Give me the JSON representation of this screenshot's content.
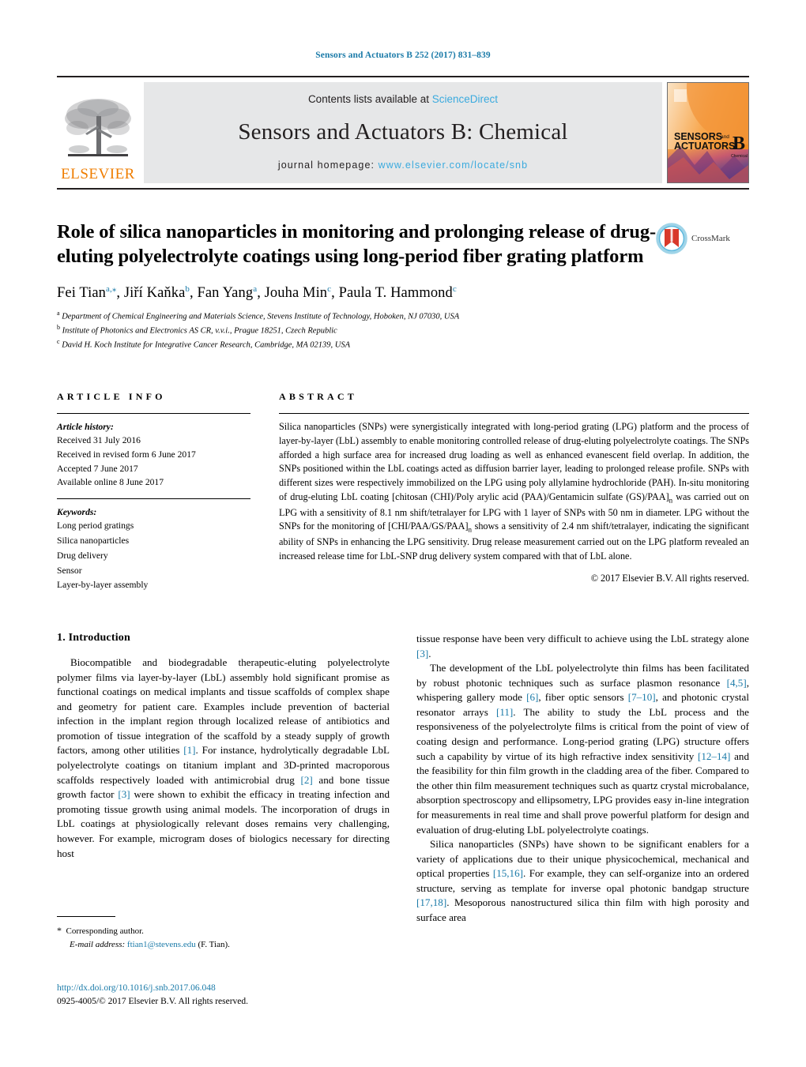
{
  "running_head": "Sensors and Actuators B 252 (2017) 831–839",
  "masthead": {
    "publisher_name": "ELSEVIER",
    "contents_prefix": "Contents lists available at ",
    "contents_link": "ScienceDirect",
    "journal_title": "Sensors and Actuators B: Chemical",
    "homepage_prefix": "journal homepage: ",
    "homepage_url": "www.elsevier.com/locate/snb",
    "cover_line1": "SENSORS",
    "cover_and": "and",
    "cover_line2": "ACTUATORS",
    "cover_letter": "B",
    "cover_sub": "Chemical"
  },
  "title": "Role of silica nanoparticles in monitoring and prolonging release of drug-eluting polyelectrolyte coatings using long-period fiber grating platform",
  "crossmark_label": "CrossMark",
  "authors_html": "Fei Tian<sup>a,⁎</sup>, Jiří Kaňka<sup>b</sup>, Fan Yang<sup>a</sup>, Jouha Min<sup>c</sup>, Paula T. Hammond<sup>c</sup>",
  "affiliations": [
    {
      "marker": "a",
      "text": "Department of Chemical Engineering and Materials Science, Stevens Institute of Technology, Hoboken, NJ 07030, USA"
    },
    {
      "marker": "b",
      "text": "Institute of Photonics and Electronics AS CR, v.v.i., Prague 18251, Czech Republic"
    },
    {
      "marker": "c",
      "text": "David H. Koch Institute for Integrative Cancer Research, Cambridge, MA 02139, USA"
    }
  ],
  "article_info": {
    "kicker": "ARTICLE INFO",
    "history_heading": "Article history:",
    "history": [
      "Received 31 July 2016",
      "Received in revised form 6 June 2017",
      "Accepted 7 June 2017",
      "Available online 8 June 2017"
    ],
    "keywords_heading": "Keywords:",
    "keywords": [
      "Long period gratings",
      "Silica nanoparticles",
      "Drug delivery",
      "Sensor",
      "Layer-by-layer assembly"
    ]
  },
  "abstract": {
    "kicker": "ABSTRACT",
    "text_html": "Silica nanoparticles (SNPs) were synergistically integrated with long-period grating (LPG) platform and the process of layer-by-layer (LbL) assembly to enable monitoring controlled release of drug-eluting polyelectrolyte coatings. The SNPs afforded a high surface area for increased drug loading as well as enhanced evanescent field overlap. In addition, the SNPs positioned within the LbL coatings acted as diffusion barrier layer, leading to prolonged release profile. SNPs with different sizes were respectively immobilized on the LPG using poly allylamine hydrochloride (PAH). In-situ monitoring of drug-eluting LbL coating [chitosan (CHI)/Poly arylic acid (PAA)/Gentamicin sulfate (GS)/PAA]<sub>n</sub> was carried out on LPG with a sensitivity of 8.1 nm shift/tetralayer for LPG with 1 layer of SNPs with 50 nm in diameter. LPG without the SNPs for the monitoring of [CHI/PAA/GS/PAA]<sub>n</sub> shows a sensitivity of 2.4 nm shift/tetralayer, indicating the significant ability of SNPs in enhancing the LPG sensitivity. Drug release measurement carried out on the LPG platform revealed an increased release time for LbL-SNP drug delivery system compared with that of LbL alone.",
    "copyright": "© 2017 Elsevier B.V. All rights reserved."
  },
  "body": {
    "section_title": "1.  Introduction",
    "left_paragraphs_html": [
      "Biocompatible and biodegradable therapeutic-eluting polyelectrolyte polymer films via layer-by-layer (LbL) assembly hold significant promise as functional coatings on medical implants and tissue scaffolds of complex shape and geometry for patient care. Examples include prevention of bacterial infection in the implant region through localized release of antibiotics and promotion of tissue integration of the scaffold by a steady supply of growth factors, among other utilities <span class=\"ref\">[1]</span>. For instance, hydrolytically degradable LbL polyelectrolyte coatings on titanium implant and 3D-printed macroporous scaffolds respectively loaded with antimicrobial drug <span class=\"ref\">[2]</span> and bone tissue growth factor <span class=\"ref\">[3]</span> were shown to exhibit the efficacy in treating infection and promoting tissue growth using animal models. The incorporation of drugs in LbL coatings at physiologically relevant doses remains very challenging, however. For example, microgram doses of biologics necessary for directing host"
    ],
    "right_paragraphs_html": [
      "tissue response have been very difficult to achieve using the LbL strategy alone <span class=\"ref\">[3]</span>.",
      "The development of the LbL polyelectrolyte thin films has been facilitated by robust photonic techniques such as surface plasmon resonance <span class=\"ref\">[4,5]</span>, whispering gallery mode <span class=\"ref\">[6]</span>, fiber optic sensors <span class=\"ref\">[7–10]</span>, and photonic crystal resonator arrays <span class=\"ref\">[11]</span>. The ability to study the LbL process and the responsiveness of the polyelectrolyte films is critical from the point of view of coating design and performance. Long-period grating (LPG) structure offers such a capability by virtue of its high refractive index sensitivity <span class=\"ref\">[12–14]</span> and the feasibility for thin film growth in the cladding area of the fiber. Compared to the other thin film measurement techniques such as quartz crystal microbalance, absorption spectroscopy and ellipsometry, LPG provides easy in-line integration for measurements in real time and shall prove powerful platform for design and evaluation of drug-eluting LbL polyelectrolyte coatings.",
      "Silica nanoparticles (SNPs) have shown to be significant enablers for a variety of applications due to their unique physicochemical, mechanical and optical properties <span class=\"ref\">[15,16]</span>. For example, they can self-organize into an ordered structure, serving as template for inverse opal photonic bandgap structure <span class=\"ref\">[17,18]</span>. Mesoporous nanostructured silica thin film with high porosity and surface area"
    ]
  },
  "footnote": {
    "corresponding": "Corresponding author.",
    "email_label": "E-mail address:",
    "email": "ftian1@stevens.edu",
    "email_suffix": "(F. Tian)."
  },
  "footer": {
    "doi": "http://dx.doi.org/10.1016/j.snb.2017.06.048",
    "issn": "0925-4005/© 2017 Elsevier B.V. All rights reserved."
  },
  "colors": {
    "link_blue": "#1a7aa8",
    "sciencedirect_blue": "#3aaade",
    "elsevier_orange": "#ef7d00",
    "band_gray": "#e6e7e8"
  }
}
